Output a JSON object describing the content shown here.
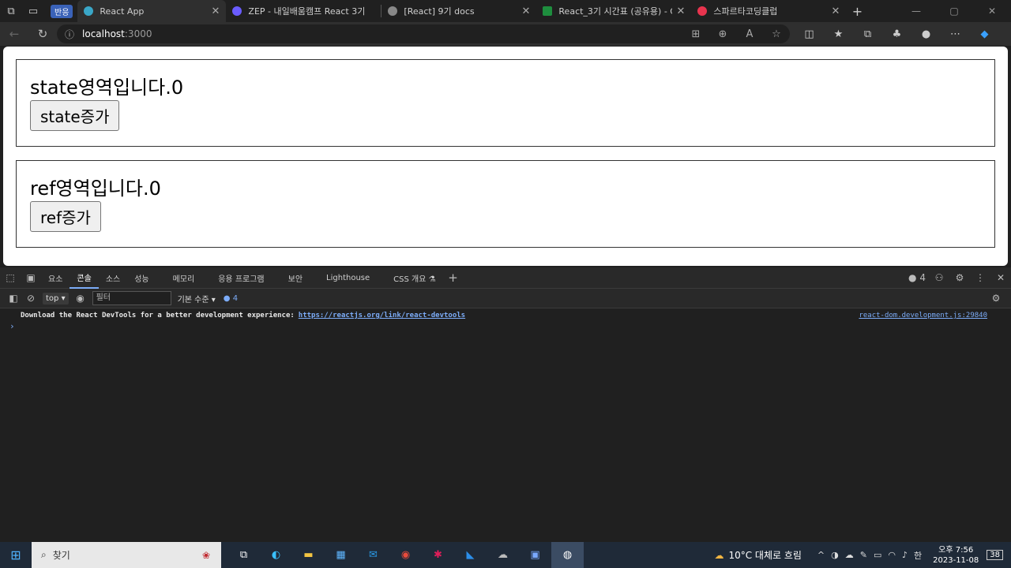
{
  "browser": {
    "tabs": [
      {
        "label": "React App",
        "active": true
      },
      {
        "label": "ZEP - 내일배움캠프 React 3기",
        "active": false
      },
      {
        "label": "[React] 9기 docs",
        "active": false
      },
      {
        "label": "React_3기 시간표 (공유용) - Goo",
        "active": false
      },
      {
        "label": "스파르타코딩클럽",
        "active": false
      }
    ],
    "badge": "반응",
    "address_host": "localhost",
    "address_port": ":3000"
  },
  "page": {
    "state_text": "state영역입니다.0",
    "state_button": "state증가",
    "ref_text": "ref영역입니다.0",
    "ref_button": "ref증가"
  },
  "devtools": {
    "tabs": [
      "요소",
      "콘솔",
      "소스",
      "성능",
      "메모리",
      "응용 프로그램",
      "보안",
      "Lighthouse",
      "CSS 개요 ⚗"
    ],
    "active_tab": "콘솔",
    "issues_count": "4",
    "context": "top",
    "filter_placeholder": "필터",
    "level": "기본 수준",
    "message_count": "4",
    "console_message": "Download the React DevTools for a better development experience:",
    "console_link": "https://reactjs.org/link/react-devtools",
    "console_source": "react-dom.development.js:29840"
  },
  "taskbar": {
    "search_label": "찾기",
    "weather": "10°C  대체로 흐림",
    "time": "오후 7:56",
    "date": "2023-11-08",
    "ime": "한",
    "notifications": "38"
  }
}
